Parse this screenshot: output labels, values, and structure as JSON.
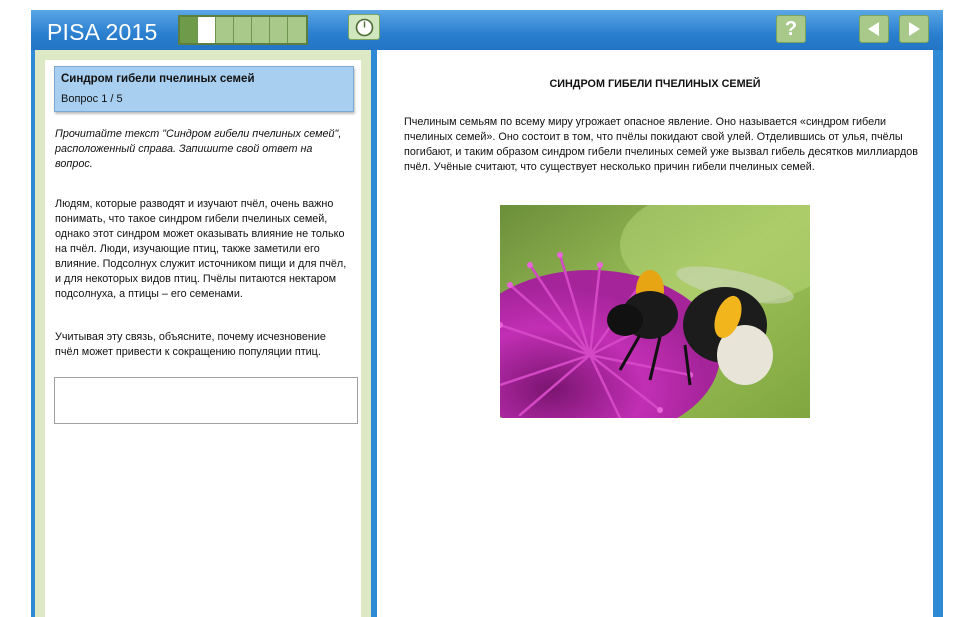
{
  "app": {
    "title": "PISA 2015"
  },
  "toolbar": {
    "progress_segments": [
      "done",
      "current",
      "todo",
      "todo",
      "todo",
      "todo",
      "todo"
    ],
    "timer_icon": "clock-icon",
    "help_label": "?",
    "prev_icon": "triangle-left-icon",
    "next_icon": "triangle-right-icon"
  },
  "question": {
    "title": "Синдром гибели пчелиных семей",
    "number": "Вопрос 1 / 5",
    "instruction": "Прочитайте текст \"Синдром гибели пчелиных семей\", расположенный справа. Запишите свой ответ на вопрос.",
    "paragraph1": "Людям, которые разводят и изучают пчёл, очень важно понимать, что такое синдром гибели пчелиных семей, однако этот синдром может оказывать влияние не только на пчёл. Люди, изучающие птиц, также заметили его влияние. Подсолнух служит источником пищи и для пчёл, и для некоторых видов птиц. Пчёлы питаются нектаром подсолнуха, а птицы – его семенами.",
    "paragraph2": "Учитывая эту связь, объясните, почему исчезновение пчёл может привести к сокращению популяции птиц.",
    "answer_value": ""
  },
  "article": {
    "title": "СИНДРОМ ГИБЕЛИ ПЧЕЛИНЫХ СЕМЕЙ",
    "text": "Пчелиным семьям по всему миру угрожает опасное явление. Оно называется «синдром гибели пчелиных семей». Оно состоит в том, что пчёлы покидают свой улей. Отделившись от улья, пчёлы погибают, и таким образом синдром гибели пчелиных семей уже вызвал гибель десятков миллиардов пчёл. Учёные считают, что существует несколько причин гибели пчелиных семей."
  },
  "colors": {
    "frame_blue": "#2f8ad6",
    "panel_green": "#dde8c4",
    "button_green": "#a8c98a",
    "question_header_blue": "#a8cff0"
  }
}
